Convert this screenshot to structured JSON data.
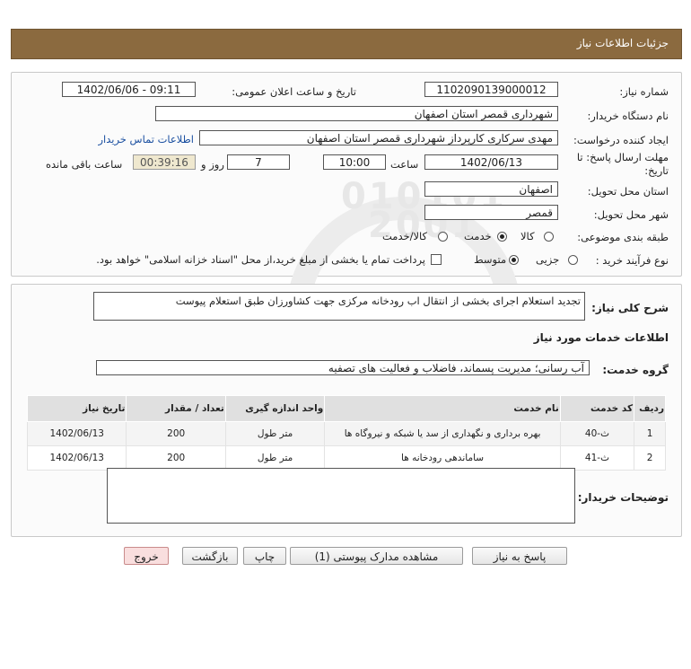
{
  "header": {
    "title": "جزئیات اطلاعات نیاز"
  },
  "watermark": {
    "digits_top": "010101",
    "digits_mid": "2001",
    "brand": "ParsNamadData",
    "tagline1": "مرکز فراخوان استعلام",
    "tagline2": "پایگاه اطلاع رسانی مناقصه و مزایده",
    "phone": "۰۲۱-۸۸۳۴۹۶۷۰-۵"
  },
  "form": {
    "need_number": {
      "label": "شماره نیاز:",
      "value": "1102090139000012"
    },
    "announce_datetime": {
      "label": "تاریخ و ساعت اعلان عمومی:",
      "value": "1402/06/06 - 09:11"
    },
    "buyer_org": {
      "label": "نام دستگاه خریدار:",
      "value": "شهرداری قمصر استان اصفهان"
    },
    "requester": {
      "label": "ایجاد کننده درخواست:",
      "value": "مهدی سرکاری کارپرداز شهرداری قمصر استان اصفهان",
      "contact_link": "اطلاعات تماس خریدار"
    },
    "deadline": {
      "label_line1": "مهلت ارسال پاسخ: تا",
      "label_line2": "تاریخ:",
      "date": "1402/06/13",
      "time_label": "ساعت",
      "time": "10:00",
      "days": "7",
      "days_label": "روز و",
      "remaining": "00:39:16",
      "remaining_label": "ساعت باقی مانده"
    },
    "delivery_province": {
      "label": "استان محل تحویل:",
      "value": "اصفهان"
    },
    "delivery_city": {
      "label": "شهر محل تحویل:",
      "value": "قمصر"
    },
    "category": {
      "label": "طبقه بندی موضوعی:",
      "options": [
        "کالا",
        "خدمت",
        "کالا/خدمت"
      ],
      "selected": "خدمت"
    },
    "purchase_process": {
      "label": "نوع فرآیند خرید :",
      "options": [
        "جزیی",
        "متوسط"
      ],
      "selected": "متوسط",
      "treasury_note": "پرداخت تمام یا بخشی از مبلغ خرید،از محل \"اسناد خزانه اسلامی\" خواهد بود."
    }
  },
  "summary": {
    "label": "شرح کلی نیاز:",
    "value": "تجدید استعلام اجرای بخشی از انتقال اب رودخانه مرکزی جهت کشاورزان طبق استعلام پیوست"
  },
  "services": {
    "section_title": "اطلاعات خدمات مورد نیاز",
    "group_label": "گروه خدمت:",
    "group_value": "آب رسانی؛ مدیریت پسماند، فاضلاب و فعالیت های تصفیه",
    "columns": [
      "ردیف",
      "کد خدمت",
      "نام خدمت",
      "واحد اندازه گیری",
      "تعداد / مقدار",
      "تاریخ نیاز"
    ],
    "rows": [
      {
        "row": "1",
        "code": "ث-40",
        "name": "بهره برداری و نگهداری از سد یا شبکه و نیروگاه ها",
        "unit": "متر طول",
        "qty": "200",
        "date": "1402/06/13"
      },
      {
        "row": "2",
        "code": "ث-41",
        "name": "ساماندهی رودخانه ها",
        "unit": "متر طول",
        "qty": "200",
        "date": "1402/06/13"
      }
    ]
  },
  "buyer_notes": {
    "label": "توضیحات خریدار:",
    "value": ""
  },
  "buttons": {
    "reply": "پاسخ به نیاز",
    "attachments": "مشاهده مدارک پیوستی (1)",
    "print": "چاپ",
    "back": "بازگشت",
    "exit": "خروج"
  },
  "colors": {
    "header_bg": "#8b6a3f",
    "link": "#1a4fa0",
    "timer_bg": "#efe8cf",
    "exit_bg": "#f9dede"
  }
}
